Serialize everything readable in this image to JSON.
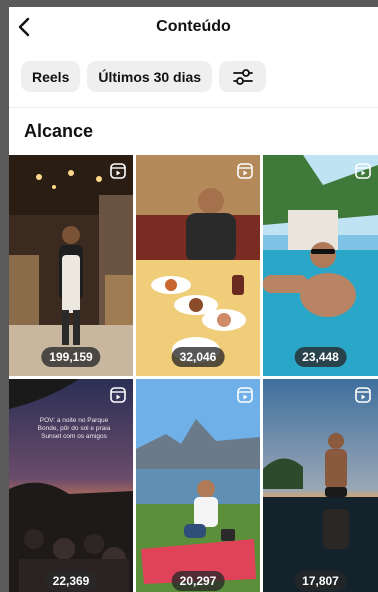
{
  "header": {
    "title": "Conteúdo",
    "back_icon": "back-arrow-icon"
  },
  "filters": [
    {
      "label": "Reels"
    },
    {
      "label": "Últimos 30 dias"
    },
    {
      "label": "",
      "icon": "sliders-icon"
    }
  ],
  "section": {
    "title": "Alcance"
  },
  "posts": [
    {
      "views": "199,159",
      "type": "reel"
    },
    {
      "views": "32,046",
      "type": "reel"
    },
    {
      "views": "23,448",
      "type": "reel"
    },
    {
      "views": "22,369",
      "type": "reel",
      "caption": "POV: a noite no Parque Bonde, pôr do sol e praia Sunset com os amigos"
    },
    {
      "views": "20,297",
      "type": "reel"
    },
    {
      "views": "17,807",
      "type": "reel"
    }
  ]
}
